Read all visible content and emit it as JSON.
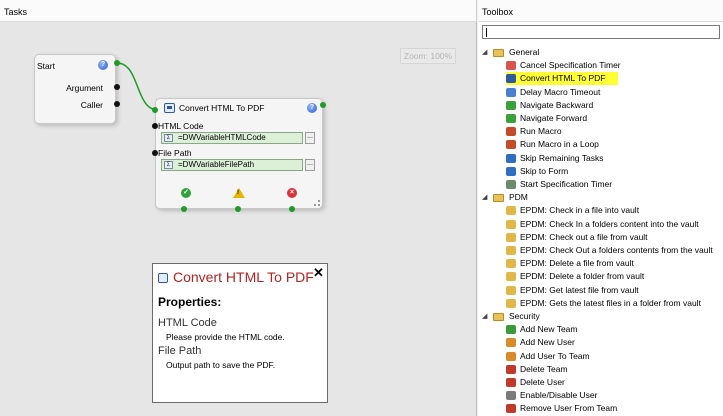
{
  "tasks": {
    "title": "Tasks",
    "zoom": "Zoom: 100%"
  },
  "start_node": {
    "title": "Start",
    "help": "?",
    "ports": [
      "Argument",
      "Caller"
    ]
  },
  "convert_node": {
    "title": "Convert HTML To PDF",
    "help": "?",
    "fields": [
      {
        "label": "HTML Code",
        "value": "=DWVariableHTMLCode",
        "sigma": "Σ",
        "browse": "..."
      },
      {
        "label": "File Path",
        "value": "=DWVariableFilePath",
        "sigma": "Σ",
        "browse": "..."
      }
    ],
    "status": {
      "ok": "✓",
      "warn": "!",
      "err": "×"
    }
  },
  "tooltip": {
    "title": "Convert HTML To PDF",
    "close": "✕",
    "heading": "Properties:",
    "props": [
      {
        "name": "HTML Code",
        "desc": "Please provide the HTML code."
      },
      {
        "name": "File Path",
        "desc": "Output path to save the PDF."
      }
    ]
  },
  "toolbox": {
    "title": "Toolbox",
    "search_value": "",
    "groups": [
      {
        "name": "General",
        "expander": "◢",
        "items": [
          {
            "label": "Cancel Specification Timer",
            "icon": "timer-cancel-icon",
            "color": "#d9534f"
          },
          {
            "label": "Convert HTML To PDF",
            "icon": "convert-pdf-icon",
            "color": "#2c5aa0",
            "highlighted": true
          },
          {
            "label": "Delay Macro Timeout",
            "icon": "delay-icon",
            "color": "#4a7fd0"
          },
          {
            "label": "Navigate Backward",
            "icon": "arrow-left-icon",
            "color": "#3aa13a"
          },
          {
            "label": "Navigate Forward",
            "icon": "arrow-right-icon",
            "color": "#3aa13a"
          },
          {
            "label": "Run Macro",
            "icon": "macro-icon",
            "color": "#c44b2a"
          },
          {
            "label": "Run Macro in a Loop",
            "icon": "macro-loop-icon",
            "color": "#c44b2a"
          },
          {
            "label": "Skip Remaining Tasks",
            "icon": "skip-icon",
            "color": "#2f6fc0"
          },
          {
            "label": "Skip to Form",
            "icon": "skip-form-icon",
            "color": "#2f6fc0"
          },
          {
            "label": "Start Specification Timer",
            "icon": "timer-start-icon",
            "color": "#6a8c6a"
          }
        ]
      },
      {
        "name": "PDM",
        "expander": "◢",
        "items": [
          {
            "label": "EPDM: Check in a file into vault",
            "icon": "pdm-icon",
            "color": "#e0b84a"
          },
          {
            "label": "EPDM: Check In a folders content into the vault",
            "icon": "pdm-icon",
            "color": "#e0b84a"
          },
          {
            "label": "EPDM: Check out a file from vault",
            "icon": "pdm-icon",
            "color": "#e0b84a"
          },
          {
            "label": "EPDM: Check Out a folders contents from the vault",
            "icon": "pdm-icon",
            "color": "#e0b84a"
          },
          {
            "label": "EPDM: Delete a file from vault",
            "icon": "pdm-icon",
            "color": "#e0b84a"
          },
          {
            "label": "EPDM: Delete a folder from vault",
            "icon": "pdm-icon",
            "color": "#e0b84a"
          },
          {
            "label": "EPDM: Get latest file from vault",
            "icon": "pdm-icon",
            "color": "#e0b84a"
          },
          {
            "label": "EPDM: Gets the latest files in a folder from vault",
            "icon": "pdm-icon",
            "color": "#e0b84a"
          }
        ]
      },
      {
        "name": "Security",
        "expander": "◢",
        "items": [
          {
            "label": "Add New Team",
            "icon": "team-add-icon",
            "color": "#3a9a3a"
          },
          {
            "label": "Add New User",
            "icon": "user-add-icon",
            "color": "#d98a2b"
          },
          {
            "label": "Add User To Team",
            "icon": "user-team-icon",
            "color": "#d98a2b"
          },
          {
            "label": "Delete Team",
            "icon": "team-delete-icon",
            "color": "#c0392b"
          },
          {
            "label": "Delete User",
            "icon": "user-delete-icon",
            "color": "#c0392b"
          },
          {
            "label": "Enable/Disable User",
            "icon": "user-toggle-icon",
            "color": "#7a7a7a"
          },
          {
            "label": "Remove User From Team",
            "icon": "user-remove-icon",
            "color": "#c0392b"
          }
        ]
      }
    ]
  }
}
